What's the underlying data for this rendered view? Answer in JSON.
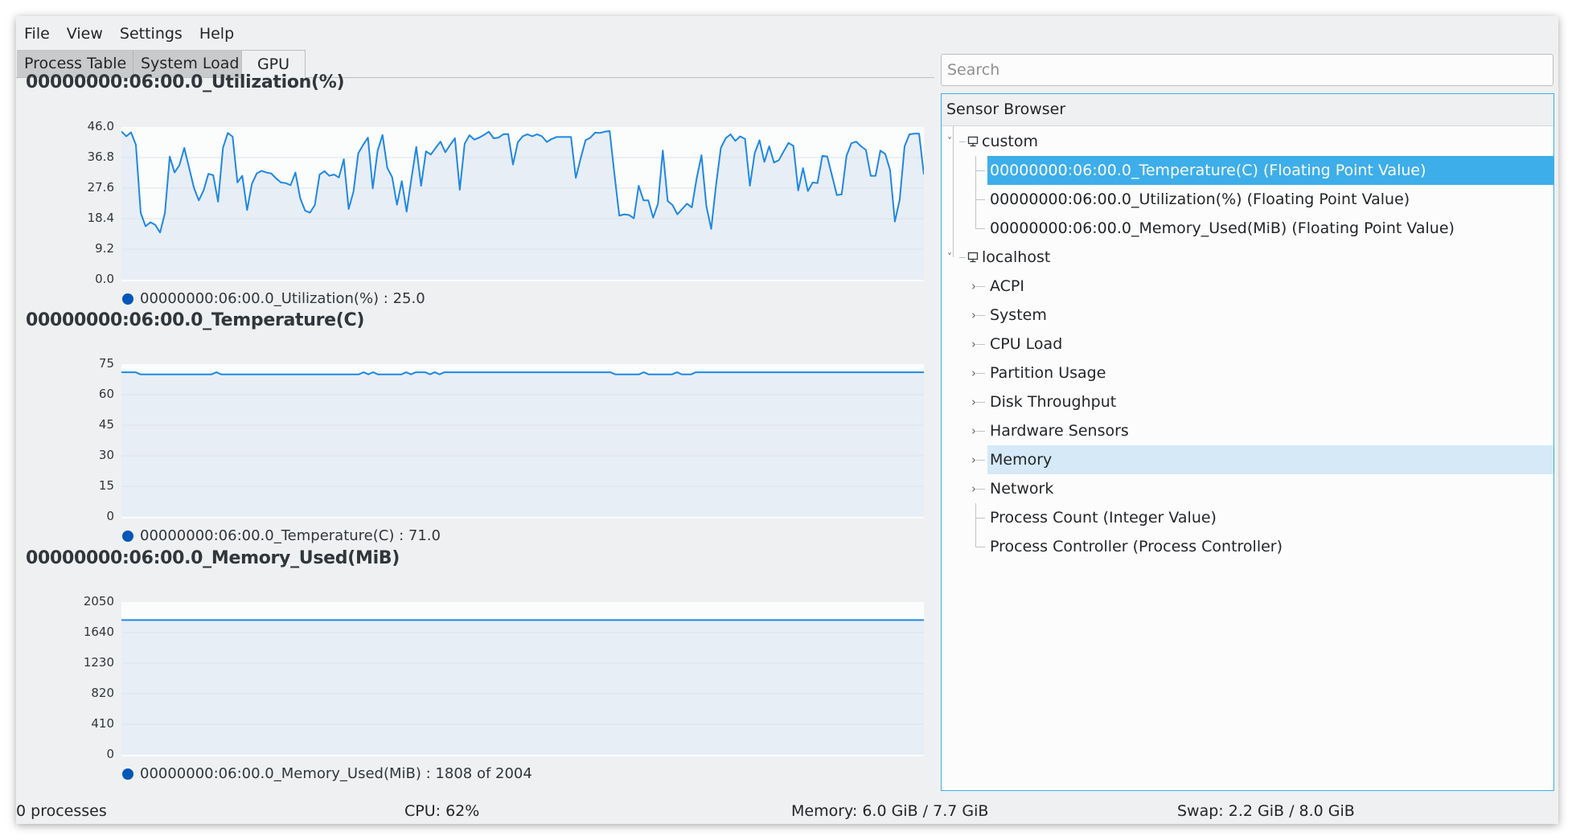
{
  "menu": [
    "File",
    "View",
    "Settings",
    "Help"
  ],
  "tabs": [
    {
      "label": "Process Table",
      "active": false
    },
    {
      "label": "System Load",
      "active": false
    },
    {
      "label": "GPU",
      "active": true
    }
  ],
  "colors": {
    "accent": "#3daee9",
    "line": "#1e88e5",
    "fill": "#e8eef6",
    "plot_bg": "#fbfcfc",
    "legend_dot": "#0057b8",
    "hover": "#d5e9f7"
  },
  "chart_data": [
    {
      "type": "line",
      "title": "00000000:06:00.0_Utilization(%)",
      "yticks": [
        "46.0",
        "36.8",
        "27.6",
        "18.4",
        "9.2",
        "0.0"
      ],
      "ylim": [
        0,
        46
      ],
      "legend": "00000000:06:00.0_Utilization(%) : 25.0",
      "current": 25.0,
      "values": [
        44.7,
        43.2,
        44.4,
        40.6,
        20.1,
        16.1,
        17.3,
        16.5,
        14.2,
        20.1,
        37.1,
        32.3,
        34.5,
        39.7,
        33.7,
        27.7,
        23.9,
        26.9,
        31.9,
        31.5,
        23.5,
        39.7,
        44.2,
        43.1,
        29.3,
        31.3,
        21.0,
        28.9,
        32.0,
        32.8,
        32.3,
        32.0,
        30.5,
        29.3,
        29.1,
        28.5,
        32.3,
        24.5,
        20.8,
        20.2,
        22.5,
        31.7,
        32.7,
        31.3,
        31.7,
        30.8,
        36.3,
        21.3,
        26.5,
        38.1,
        40.6,
        42.8,
        27.5,
        38.8,
        43.6,
        33.7,
        30.9,
        22.6,
        29.7,
        20.5,
        30.5,
        40.0,
        28.3,
        38.7,
        37.7,
        39.7,
        41.6,
        38.4,
        40.6,
        42.6,
        27.1,
        41.0,
        43.5,
        42.2,
        42.8,
        43.6,
        44.6,
        42.6,
        42.8,
        43.8,
        43.9,
        34.7,
        41.4,
        43.2,
        43.8,
        43.2,
        43.8,
        43.2,
        41.5,
        42.4,
        43.0,
        43.0,
        43.0,
        43.0,
        30.7,
        36.5,
        42.0,
        42.8,
        44.3,
        44.2,
        44.6,
        44.8,
        31.7,
        19.3,
        19.7,
        19.5,
        18.5,
        28.3,
        23.9,
        23.9,
        18.7,
        22.9,
        38.9,
        23.7,
        22.5,
        19.7,
        21.3,
        22.9,
        21.8,
        30.5,
        37.5,
        22.1,
        15.3,
        28.5,
        39.7,
        42.6,
        43.8,
        41.8,
        43.2,
        42.4,
        28.3,
        38.1,
        42.0,
        35.5,
        40.2,
        35.3,
        36.0,
        38.7,
        41.2,
        40.3,
        26.9,
        33.6,
        26.7,
        29.3,
        29.1,
        37.3,
        37.1,
        31.3,
        25.5,
        25.7,
        37.3,
        41.1,
        41.6,
        40.2,
        39.1,
        31.3,
        31.3,
        38.9,
        37.9,
        33.1,
        17.5,
        24.1,
        40.2,
        43.8,
        44.0,
        44.0,
        31.7
      ]
    },
    {
      "type": "line",
      "title": "00000000:06:00.0_Temperature(C)",
      "yticks": [
        "75",
        "60",
        "45",
        "30",
        "15",
        "0"
      ],
      "ylim": [
        0,
        75
      ],
      "legend": "00000000:06:00.0_Temperature(C) : 71.0",
      "current": 71.0,
      "values": [
        71,
        71,
        71,
        71,
        70,
        70,
        70,
        70,
        70,
        70,
        70,
        70,
        70,
        70,
        70,
        70,
        70,
        70,
        70,
        70,
        71,
        70,
        70,
        70,
        70,
        70,
        70,
        70,
        70,
        70,
        70,
        70,
        70,
        70,
        70,
        70,
        70,
        70,
        70,
        70,
        70,
        70,
        70,
        70,
        70,
        70,
        70,
        70,
        70,
        70,
        70,
        71,
        70,
        71,
        70,
        70,
        70,
        70,
        70,
        70,
        71,
        70,
        71,
        71,
        71,
        70,
        71,
        70,
        71,
        71,
        71,
        71,
        71,
        71,
        71,
        71,
        71,
        71,
        71,
        71,
        71,
        71,
        71,
        71,
        71,
        71,
        71,
        71,
        71,
        71,
        71,
        71,
        71,
        71,
        71,
        71,
        71,
        71,
        71,
        71,
        71,
        71,
        71,
        71,
        70,
        70,
        70,
        70,
        70,
        70,
        71,
        70,
        70,
        70,
        70,
        70,
        70,
        71,
        70,
        70,
        70,
        71,
        71,
        71,
        71,
        71,
        71,
        71,
        71,
        71,
        71,
        71,
        71,
        71,
        71,
        71,
        71,
        71,
        71,
        71,
        71,
        71,
        71,
        71,
        71,
        71,
        71,
        71,
        71,
        71,
        71,
        71,
        71,
        71,
        71,
        71,
        71,
        71,
        71,
        71,
        71,
        71,
        71,
        71,
        71,
        71,
        71,
        71,
        71,
        71
      ]
    },
    {
      "type": "line",
      "title": "00000000:06:00.0_Memory_Used(MiB)",
      "yticks": [
        "2050",
        "1640",
        "1230",
        "820",
        "410",
        "0"
      ],
      "ylim": [
        0,
        2050
      ],
      "legend": "00000000:06:00.0_Memory_Used(MiB) : 1808 of 2004",
      "current": 1808,
      "max": 2004,
      "values": [
        1808,
        1808
      ]
    }
  ],
  "search": {
    "placeholder": "Search",
    "value": ""
  },
  "sensor_browser": {
    "title": "Sensor Browser",
    "tree": [
      {
        "label": "custom",
        "level": 0,
        "expanded": true,
        "icon": "computer-icon"
      },
      {
        "label": "00000000:06:00.0_Temperature(C) (Floating Point Value)",
        "level": 1,
        "state": "selected"
      },
      {
        "label": "00000000:06:00.0_Utilization(%) (Floating Point Value)",
        "level": 1
      },
      {
        "label": "00000000:06:00.0_Memory_Used(MiB) (Floating Point Value)",
        "level": 1,
        "last": true
      },
      {
        "label": "localhost",
        "level": 0,
        "expanded": true,
        "icon": "computer-icon"
      },
      {
        "label": "ACPI",
        "level": 1,
        "expandable": true
      },
      {
        "label": "System",
        "level": 1,
        "expandable": true
      },
      {
        "label": "CPU Load",
        "level": 1,
        "expandable": true
      },
      {
        "label": "Partition Usage",
        "level": 1,
        "expandable": true
      },
      {
        "label": "Disk Throughput",
        "level": 1,
        "expandable": true
      },
      {
        "label": "Hardware Sensors",
        "level": 1,
        "expandable": true
      },
      {
        "label": "Memory",
        "level": 1,
        "expandable": true,
        "state": "hover"
      },
      {
        "label": "Network",
        "level": 1,
        "expandable": true
      },
      {
        "label": "Process Count (Integer Value)",
        "level": 1
      },
      {
        "label": "Process Controller (Process Controller)",
        "level": 1,
        "last": true
      }
    ]
  },
  "statusbar": {
    "processes": "0 processes",
    "cpu": "CPU: 62%",
    "memory": "Memory: 6.0 GiB / 7.7 GiB",
    "swap": "Swap: 2.2 GiB / 8.0 GiB"
  }
}
